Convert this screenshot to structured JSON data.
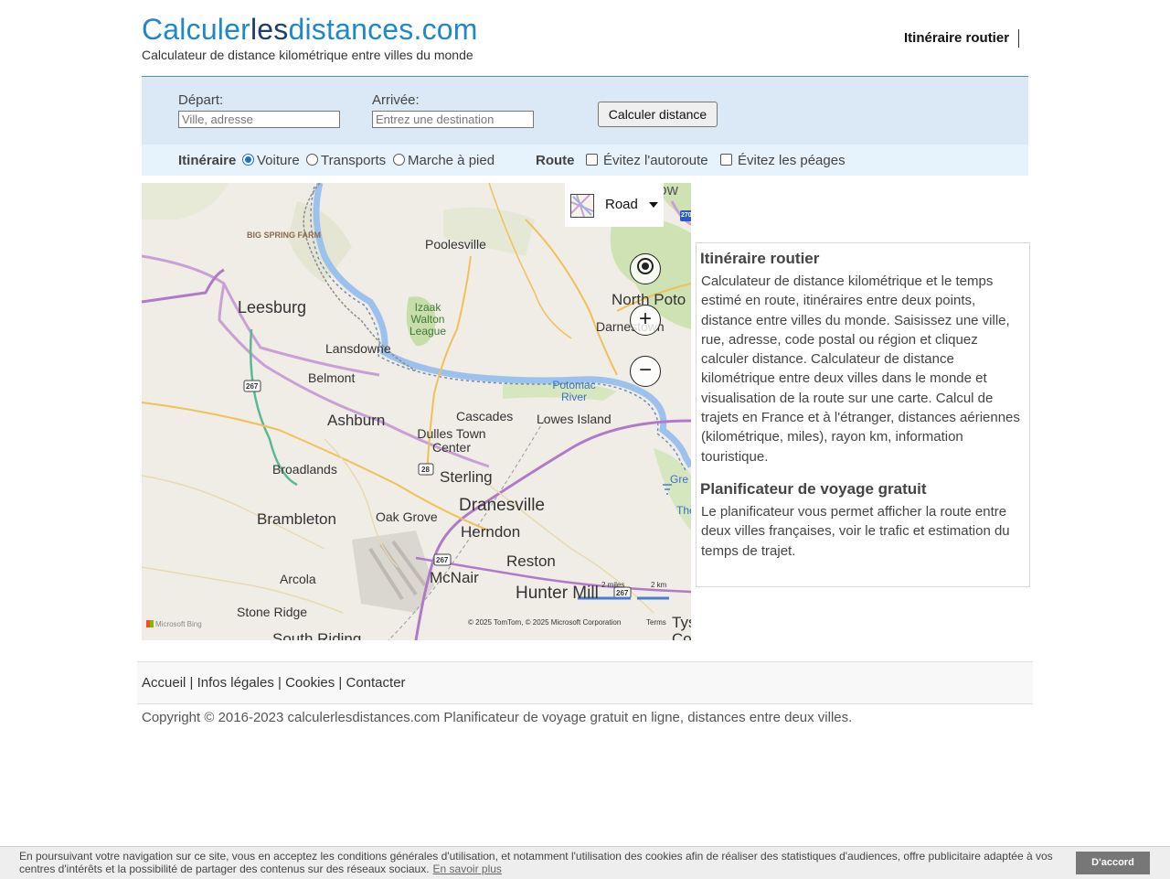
{
  "header": {
    "logo_part1": "Calculer",
    "logo_part2": "les",
    "logo_part3": "distances.com",
    "tagline": "Calculateur de distance kilométrique entre villes du monde",
    "nav_label": "Itinéraire routier"
  },
  "form": {
    "depart_label": "Départ:",
    "depart_placeholder": "Ville, adresse",
    "arrivee_label": "Arrivée:",
    "arrivee_placeholder": "Entrez une destination",
    "submit_label": "Calculer distance"
  },
  "options": {
    "itineraire_label": "Itinéraire",
    "modes": [
      {
        "label": "Voiture",
        "checked": true
      },
      {
        "label": "Transports",
        "checked": false
      },
      {
        "label": "Marche à pied",
        "checked": false
      }
    ],
    "route_label": "Route",
    "avoid": [
      {
        "label": "Évitez l'autoroute",
        "checked": false
      },
      {
        "label": "Évitez les péages",
        "checked": false
      }
    ]
  },
  "map": {
    "style_selector": "Road",
    "places": [
      "Germantow",
      "BIG SPRING FARM",
      "Poolesville",
      "Leesburg",
      "Izaak Walton League",
      "North Poto",
      "Darnestown",
      "Lansdowne",
      "Belmont",
      "Potomac River",
      "Cascades",
      "Lowes Island",
      "Ashburn",
      "Dulles Town Center",
      "Sterling",
      "Broadlands",
      "Dranesville",
      "Brambleton",
      "Oak Grove",
      "Herndon",
      "Reston",
      "Arcola",
      "McNair",
      "Hunter Mill",
      "Stone Ridge",
      "South Riding",
      "Gre",
      "The",
      "Tys",
      "Co"
    ],
    "shields": [
      "267",
      "28",
      "267",
      "267",
      "270"
    ],
    "scale_miles": "2 miles",
    "scale_km": "2 km",
    "attribution": "© 2025 TomTom, © 2025 Microsoft Corporation",
    "terms": "Terms",
    "brand": "Microsoft Bing"
  },
  "info": {
    "title1": "Itinéraire routier",
    "text1": "Calculateur de distance kilométrique et le temps estimé en route, itinéraires entre deux points, distance entre villes du monde. Saisissez une ville, rue, adresse, code postal ou région et cliquez calculer distance. Calculateur de distance kilométrique entre deux villes dans le monde et visualisation de la route sur une carte. Calcul de trajets en France et à l'étranger, distances aériennes (kilométrique, miles), rayon km, information touristique.",
    "title2": "Planificateur de voyage gratuit",
    "text2": "Le planificateur vous permet afficher la route entre deux villes françaises, voir le trafic et estimation du temps de trajet."
  },
  "footer": {
    "links": [
      "Accueil",
      "Infos légales",
      "Cookies",
      "Contacter"
    ],
    "separator": " | ",
    "copyright": "Copyright © 2016-2023 calculerlesdistances.com Planificateur de voyage gratuit en ligne, distances entre deux villes."
  },
  "cookie": {
    "message": "En poursuivant votre navigation sur ce site, vous en acceptez les conditions générales d'utilisation, et notamment l'utilisation des cookies afin de réaliser des statistiques d'audiences, offre publicitaire adaptée à vos centres d'intérêts et la possibilité de partager des contenus sur des réseaux sociaux.",
    "more": "En savoir plus",
    "accept": "D'accord"
  },
  "colors": {
    "brand_light": "#1e88c8",
    "brand_dark": "#1d3e6e",
    "form_bg": "#dbe9f7",
    "options_bg": "#e6f2fc",
    "river": "#8fb6ea"
  }
}
